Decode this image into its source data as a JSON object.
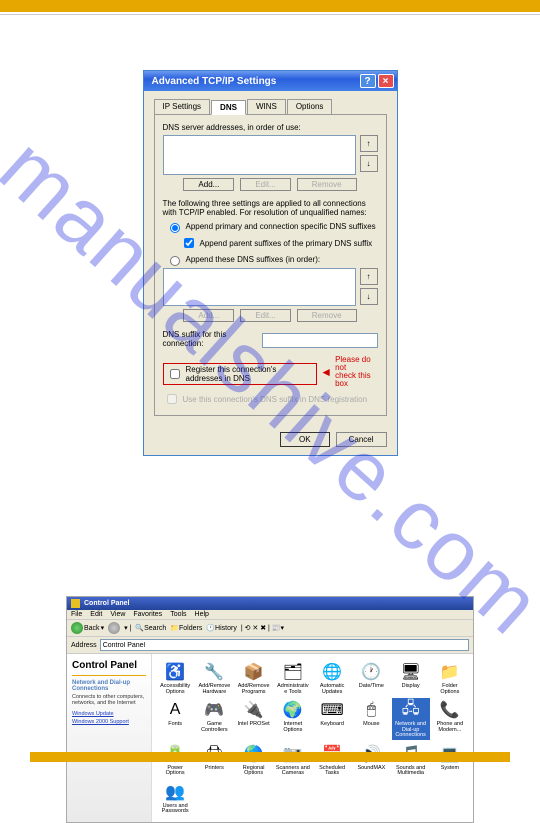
{
  "watermark": "manualshive.com",
  "dialog": {
    "title": "Advanced TCP/IP Settings",
    "tabs": [
      "IP Settings",
      "DNS",
      "WINS",
      "Options"
    ],
    "dns_label": "DNS server addresses, in order of use:",
    "add": "Add...",
    "edit": "Edit...",
    "remove": "Remove",
    "desc": "The following three settings are applied to all connections with TCP/IP enabled. For resolution of unqualified names:",
    "r1": "Append primary and connection specific DNS suffixes",
    "c1": "Append parent suffixes of the primary DNS suffix",
    "r2": "Append these DNS suffixes (in order):",
    "suffix_label": "DNS suffix for this connection:",
    "reg": "Register this connection's addresses in DNS",
    "reg2": "Use this connection's DNS suffix in DNS registration",
    "warn1": "Please do not",
    "warn2": "check this box",
    "ok": "OK",
    "cancel": "Cancel"
  },
  "cp": {
    "title": "Control Panel",
    "menus": [
      "File",
      "Edit",
      "View",
      "Favorites",
      "Tools",
      "Help"
    ],
    "back": "Back",
    "search": "Search",
    "folders": "Folders",
    "history": "History",
    "addr_label": "Address",
    "addr_val": "Control Panel",
    "side_title": "Control Panel",
    "side_sub": "Network and Dial-up Connections",
    "side_desc": "Connects to other computers, networks, and the Internet",
    "link1": "Windows Update",
    "link2": "Windows 2000 Support",
    "icons": [
      {
        "l": "Accessibility Options",
        "i": "♿"
      },
      {
        "l": "Add/Remove Hardware",
        "i": "🔧"
      },
      {
        "l": "Add/Remove Programs",
        "i": "📦"
      },
      {
        "l": "Administrative Tools",
        "i": "🗂"
      },
      {
        "l": "Automatic Updates",
        "i": "🌐"
      },
      {
        "l": "Date/Time",
        "i": "🕐"
      },
      {
        "l": "Display",
        "i": "🖥"
      },
      {
        "l": "Folder Options",
        "i": "📁"
      },
      {
        "l": "Fonts",
        "i": "A"
      },
      {
        "l": "Game Controllers",
        "i": "🎮"
      },
      {
        "l": "Intel PROSet",
        "i": "🔌"
      },
      {
        "l": "Internet Options",
        "i": "🌍"
      },
      {
        "l": "Keyboard",
        "i": "⌨"
      },
      {
        "l": "Mouse",
        "i": "🖱"
      },
      {
        "l": "Network and Dial-up Connections",
        "i": "🖧",
        "sel": true
      },
      {
        "l": "Phone and Modem...",
        "i": "📞"
      },
      {
        "l": "Power Options",
        "i": "🔋"
      },
      {
        "l": "Printers",
        "i": "🖨"
      },
      {
        "l": "Regional Options",
        "i": "🌎"
      },
      {
        "l": "Scanners and Cameras",
        "i": "📷"
      },
      {
        "l": "Scheduled Tasks",
        "i": "📅"
      },
      {
        "l": "SoundMAX",
        "i": "🔊"
      },
      {
        "l": "Sounds and Multimedia",
        "i": "🎵"
      },
      {
        "l": "System",
        "i": "💻"
      },
      {
        "l": "Users and Passwords",
        "i": "👥"
      }
    ]
  }
}
